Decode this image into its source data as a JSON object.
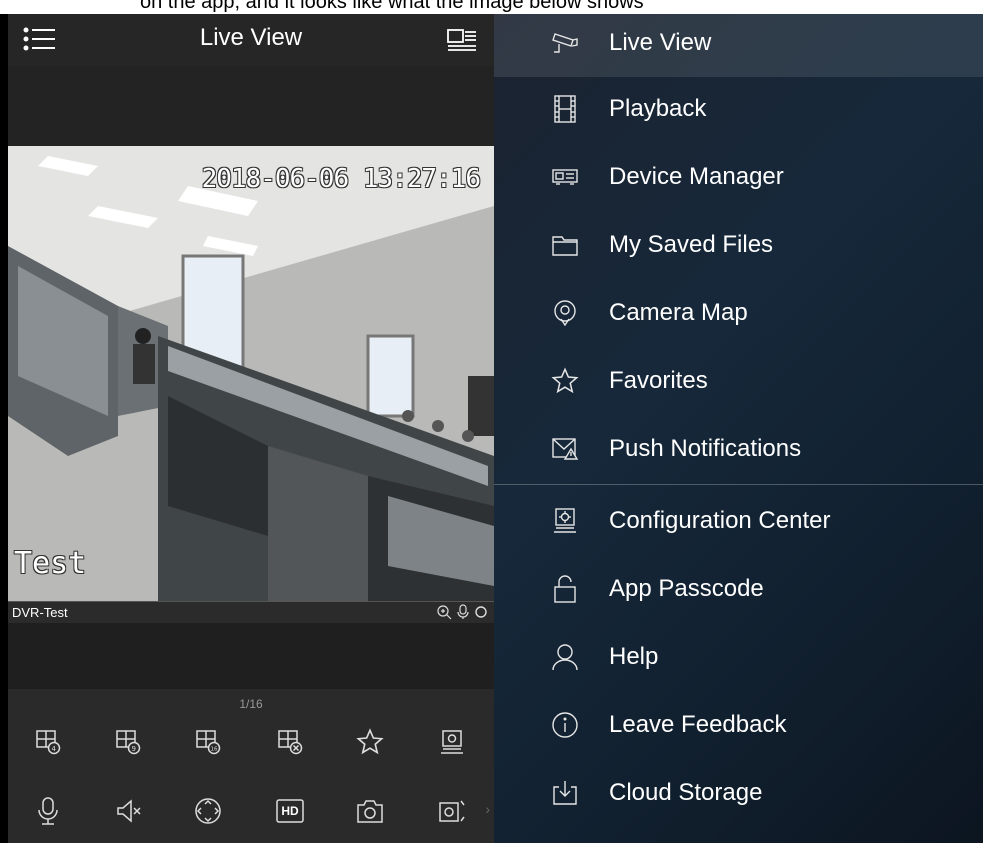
{
  "caption": "on the app, and it looks like what the image below shows",
  "header": {
    "title": "Live View"
  },
  "video": {
    "timestamp": "2018-06-06 13:27:16",
    "osd_label": "Test"
  },
  "channel": {
    "name": "DVR-Test"
  },
  "toolbar": {
    "pager": "1/16",
    "row1": [
      "split-4-icon",
      "split-9-icon",
      "split-16-icon",
      "close-split-icon",
      "star-icon",
      "config-icon"
    ],
    "row2": [
      "mic-icon",
      "mute-icon",
      "ptz-icon",
      "hd-icon",
      "snapshot-icon",
      "record-icon"
    ],
    "hd_label": "HD"
  },
  "drawer": {
    "items": [
      {
        "label": "Live View",
        "icon": "cctv-camera-icon"
      },
      {
        "label": "Playback",
        "icon": "film-icon"
      },
      {
        "label": "Device Manager",
        "icon": "dvr-device-icon"
      },
      {
        "label": "My Saved Files",
        "icon": "folder-icon"
      },
      {
        "label": "Camera Map",
        "icon": "map-pin-icon"
      },
      {
        "label": "Favorites",
        "icon": "star-icon"
      },
      {
        "label": "Push Notifications",
        "icon": "alert-mail-icon"
      },
      {
        "label": "Configuration Center",
        "icon": "settings-monitor-icon"
      },
      {
        "label": "App Passcode",
        "icon": "unlock-icon"
      },
      {
        "label": "Help",
        "icon": "person-icon"
      },
      {
        "label": "Leave Feedback",
        "icon": "info-icon"
      },
      {
        "label": "Cloud Storage",
        "icon": "download-tray-icon"
      }
    ]
  },
  "colors": {
    "drawer_bg": "#16283a",
    "panel_bg": "#1e1e1e",
    "active_row": "#2e3845"
  }
}
